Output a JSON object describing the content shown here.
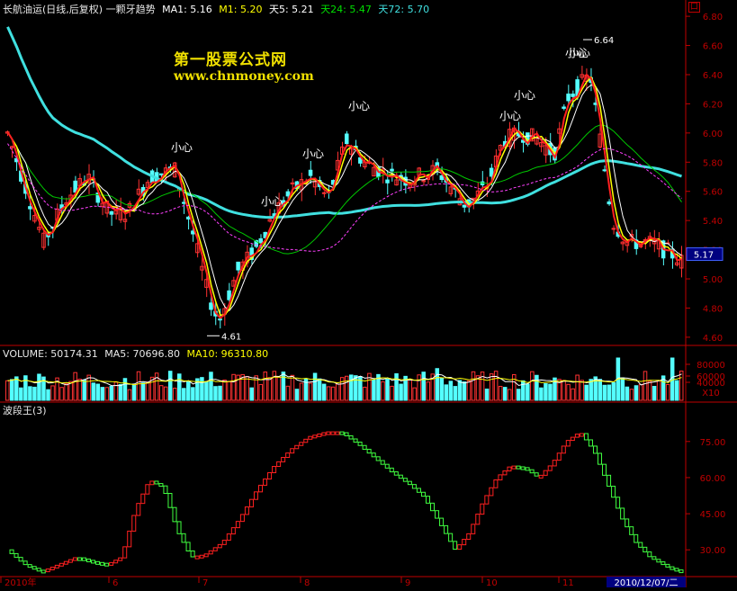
{
  "price_header": {
    "name": "长航油运(日线,后复权) 一颗牙趋势",
    "ma1_label": "MA1: 5.16",
    "m1_label": "M1: 5.20",
    "tian5_label": "天5: 5.21",
    "tian24_label": "天24: 5.47",
    "tian72_label": "天72: 5.70",
    "corner_box": "口"
  },
  "watermark": {
    "line1": "第一股票公式网",
    "line2": "www.chnmoney.com"
  },
  "price_axis": {
    "ticks": [
      "6.80",
      "6.60",
      "6.40",
      "6.20",
      "6.00",
      "5.80",
      "5.60",
      "5.40",
      "5.20",
      "5.00",
      "4.80",
      "4.60"
    ],
    "current_price": "5.17"
  },
  "annotations": {
    "low_label": "4.61",
    "high_label": "6.64",
    "warning": "小心",
    "warning_count": 8
  },
  "volume_header": {
    "volume_label": "VOLUME: 50174.31",
    "ma5_label": "MA5: 70696.80",
    "ma10_label": "MA10: 96310.80"
  },
  "volume_axis": {
    "ticks": [
      "80000",
      "60000",
      "40000"
    ],
    "unit": "X10"
  },
  "indicator_header": {
    "name": "波段王(3)"
  },
  "indicator_axis": {
    "ticks": [
      "75.00",
      "60.00",
      "45.00",
      "30.00"
    ]
  },
  "date_axis": {
    "labels": [
      "2010年",
      "6",
      "7",
      "8",
      "9",
      "10",
      "11"
    ],
    "cursor_date": "2010/12/07/二"
  },
  "colors": {
    "up": "#ff3232",
    "down": "#54ffff",
    "axis": "#c00000",
    "ma_yellow": "#ffff00",
    "ma_white": "#ffffff",
    "ma_green": "#00c800",
    "ma_cyan": "#40e0e0",
    "wave_red": "#ff2020",
    "wave_green": "#40ff40"
  }
}
